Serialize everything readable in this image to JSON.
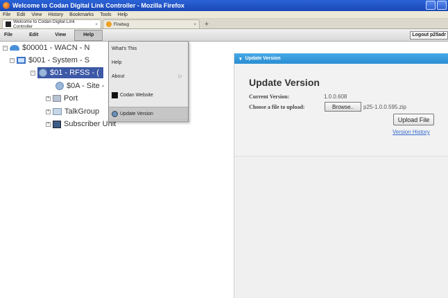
{
  "window": {
    "title": "Welcome to Codan Digital Link Controller - Mozilla Firefox"
  },
  "browser_menu": [
    "File",
    "Edit",
    "View",
    "History",
    "Bookmarks",
    "Tools",
    "Help"
  ],
  "tabs": [
    {
      "label": "Welcome to Codan Digital Link Controller",
      "close": "×"
    },
    {
      "label": "Firebug",
      "close": "×"
    }
  ],
  "new_tab": "+",
  "app_menu": {
    "file": "File",
    "edit": "Edit",
    "view": "View",
    "help": "Help"
  },
  "logout_label": "Logout p25adr",
  "tree": {
    "root": "$00001 - WACN - N",
    "system": "$001 - System - S",
    "rfss": "$01 - RFSS - (",
    "site": "$0A - Site -",
    "port": "Port",
    "talkgroup": "TalkGroup",
    "subscriber": "Subscriber Unit"
  },
  "help_menu": {
    "whats_this": "What's This",
    "help": "Help",
    "about": "About",
    "codan_website": "Codan Website",
    "update_version": "Update Version"
  },
  "panel": {
    "header": "Update Version",
    "title": "Update Version",
    "current_version_label": "Current Version:",
    "current_version_value": "1.0.0.608",
    "choose_file_label": "Choose a file to upload:",
    "browse_label": "Browse..",
    "file_name": "p25-1.0.0.595.zip",
    "upload_label": "Upload File",
    "history_link": "Version History"
  }
}
